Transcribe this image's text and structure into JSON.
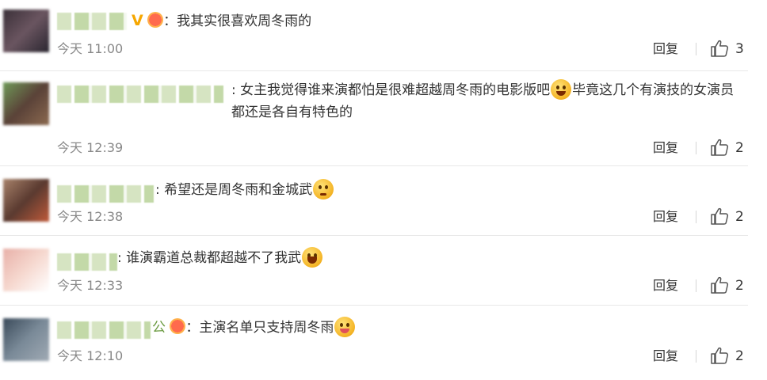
{
  "comments": [
    {
      "badge_v": "V",
      "text": "我其实很喜欢周冬雨的",
      "time": "今天 11:00",
      "reply": "回复",
      "likes": "3"
    },
    {
      "name_prefix": "",
      "text_part1": "女主我觉得谁来演都怕是很难超越周冬雨的电影版吧",
      "text_part2": "毕竟这几个有演技的女演员都还是各自有特色的",
      "time": "今天 12:39",
      "reply": "回复",
      "likes": "2"
    },
    {
      "text": "希望还是周冬雨和金城武",
      "time": "今天 12:38",
      "reply": "回复",
      "likes": "2"
    },
    {
      "text": "谁演霸道总裁都超越不了我武",
      "time": "今天 12:33",
      "reply": "回复",
      "likes": "2"
    },
    {
      "name_suffix": "公",
      "text": "主演名单只支持周冬雨",
      "time": "今天 12:10",
      "reply": "回复",
      "likes": "2"
    }
  ],
  "colors": {
    "text": "#333333",
    "time": "#888888",
    "badge": "#f6a700",
    "separator": "#e8e8e8"
  },
  "icons": [
    "like-icon",
    "emoji-laugh-tears-icon",
    "emoji-pleading-icon",
    "emoji-grin-icon",
    "emoji-yum-icon",
    "fan-heart-badge-icon"
  ]
}
